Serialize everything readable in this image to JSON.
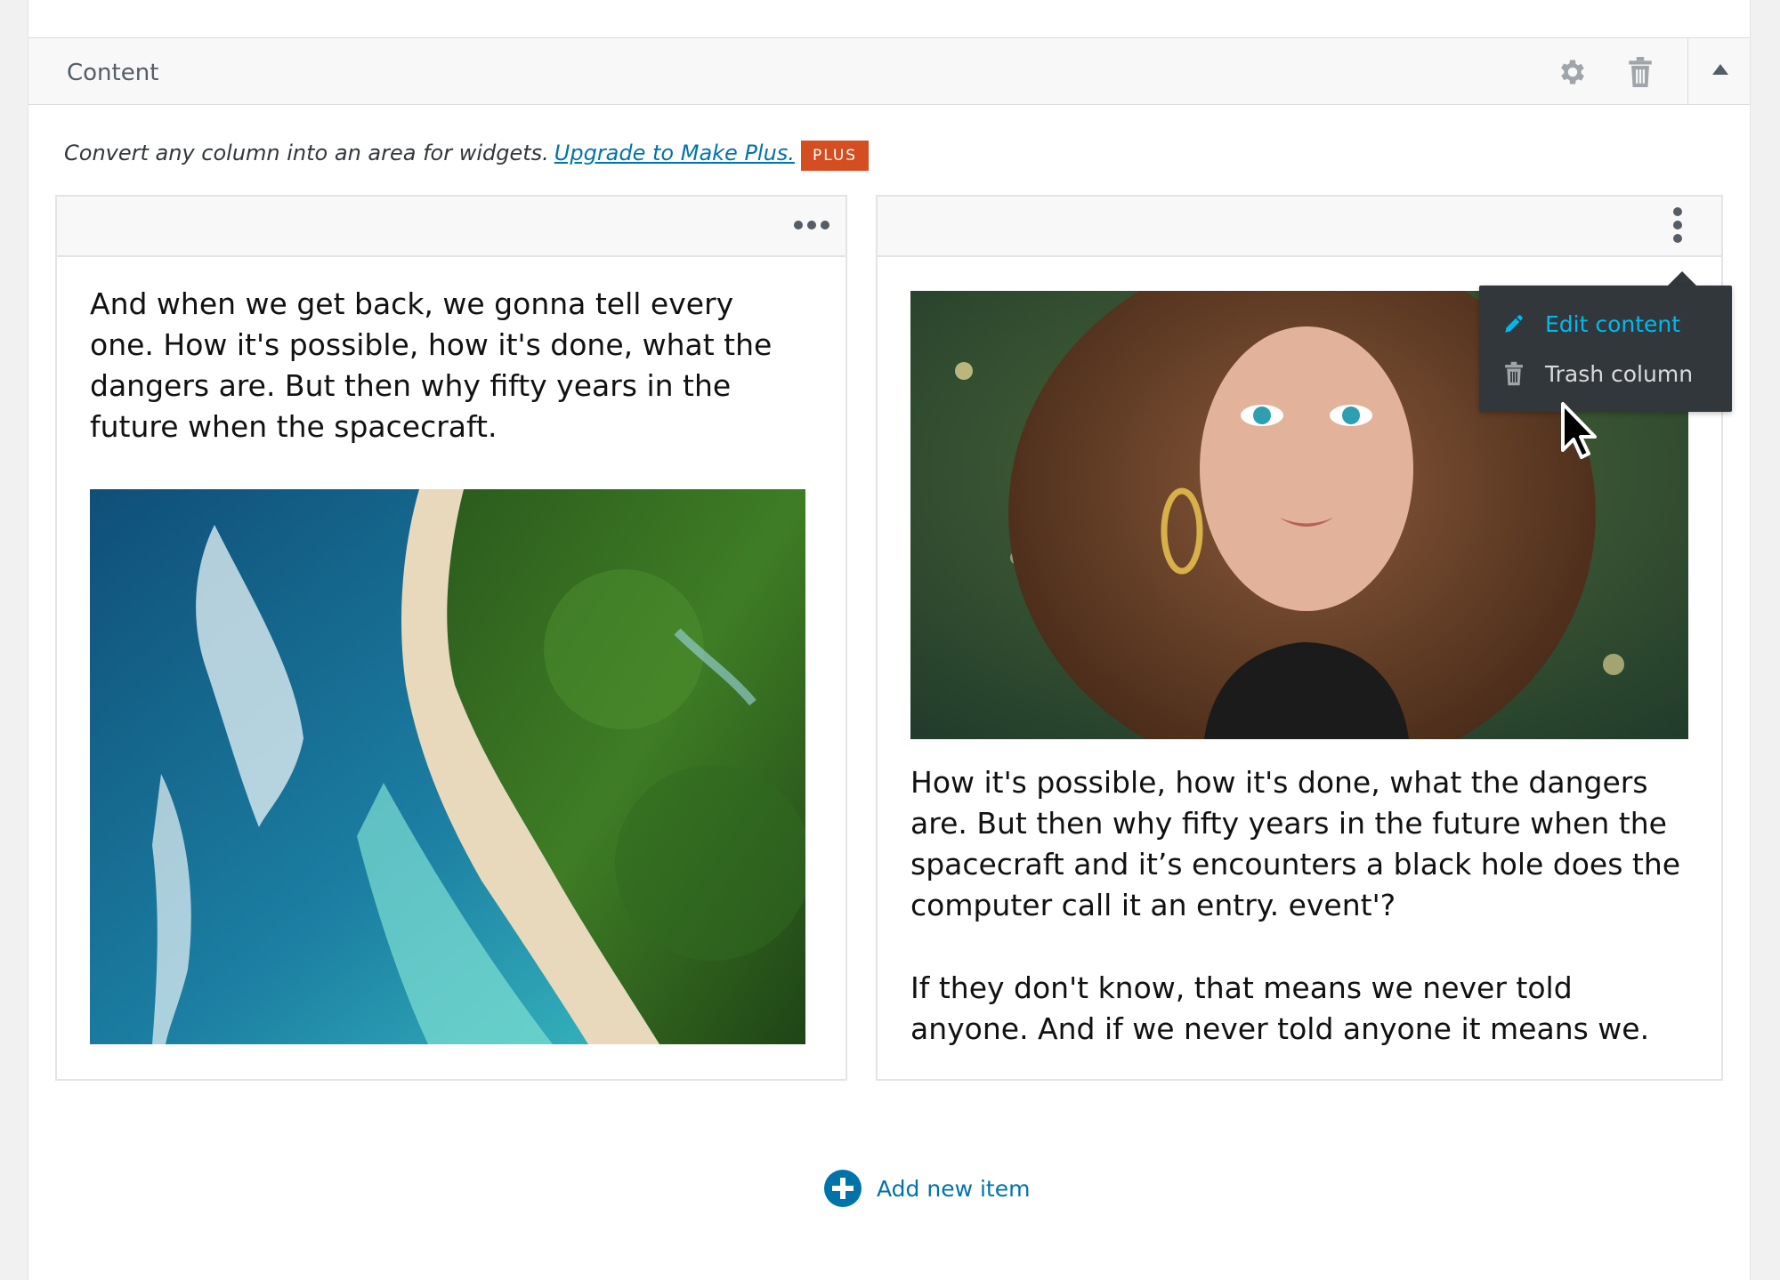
{
  "section": {
    "title": "Content",
    "icons": {
      "settings": "gear-icon",
      "delete": "trash-icon",
      "collapse": "triangle-up-icon"
    }
  },
  "notice": {
    "text": "Convert any column into an area for widgets.",
    "link": "Upgrade to Make Plus.",
    "badge": "PLUS"
  },
  "columns": [
    {
      "menu_icon": "horizontal-dots-icon",
      "paragraphs": [
        "And when we get back, we gonna tell every one. How it's possible, how it's done, what the dangers are. But then why fifty years in the future when the spacecraft."
      ],
      "image": "aerial beach photo"
    },
    {
      "menu_icon": "vertical-dots-icon",
      "image": "woman portrait photo",
      "paragraphs": [
        "How it's possible, how it's done, what the dangers are. But then why fifty years in the future when the spacecraft  and it’s encounters a black hole does the computer call it an entry. event'?",
        "If they don't know, that means we never told anyone. And if we never told anyone it means we."
      ]
    }
  ],
  "dropdown": {
    "items": [
      {
        "label": "Edit content",
        "icon": "pencil-icon"
      },
      {
        "label": "Trash column",
        "icon": "trash-icon"
      }
    ]
  },
  "footer": {
    "add_label": "Add new item",
    "add_icon": "plus-circle-icon"
  },
  "colors": {
    "accent": "#0073aa",
    "badge": "#d54e21",
    "dropdown_bg": "#32373c",
    "dropdown_active": "#00b9eb"
  }
}
